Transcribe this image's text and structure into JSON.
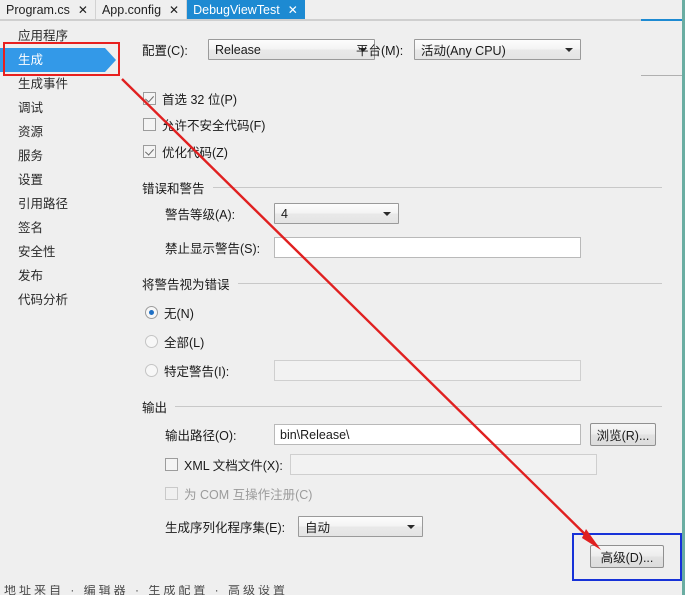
{
  "window": {
    "accent_blue": "#1d8ad2",
    "background": "#efefef",
    "highlight_red": "#e8201f",
    "highlight_blue": "#1732d8",
    "arrow_color": "#e02020"
  },
  "tabs": [
    {
      "label": "Program.cs",
      "close": "✕",
      "active": false
    },
    {
      "label": "App.config",
      "close": "✕",
      "active": false
    },
    {
      "label": "DebugViewTest",
      "close": "✕",
      "active": true
    }
  ],
  "sidebar": {
    "items": [
      {
        "label": "应用程序",
        "selected": false
      },
      {
        "label": "生成",
        "selected": true
      },
      {
        "label": "生成事件",
        "selected": false
      },
      {
        "label": "调试",
        "selected": false
      },
      {
        "label": "资源",
        "selected": false
      },
      {
        "label": "服务",
        "selected": false
      },
      {
        "label": "设置",
        "selected": false
      },
      {
        "label": "引用路径",
        "selected": false
      },
      {
        "label": "签名",
        "selected": false
      },
      {
        "label": "安全性",
        "selected": false
      },
      {
        "label": "发布",
        "selected": false
      },
      {
        "label": "代码分析",
        "selected": false
      }
    ]
  },
  "header": {
    "configuration_label": "配置(C):",
    "configuration_value": "Release",
    "platform_label": "平台(M):",
    "platform_value": "活动(Any CPU)"
  },
  "general": {
    "prefer32bit_label": "首选 32 位(P)",
    "prefer32bit_checked": true,
    "unsafe_label": "允许不安全代码(F)",
    "unsafe_checked": false,
    "optimize_label": "优化代码(Z)",
    "optimize_checked": true
  },
  "errors_warnings": {
    "group_title": "错误和警告",
    "warning_level_label": "警告等级(A):",
    "warning_level_value": "4",
    "suppress_label": "禁止显示警告(S):",
    "suppress_value": ""
  },
  "treat_warnings": {
    "group_title": "将警告视为错误",
    "options": [
      {
        "label": "无(N)",
        "selected": true
      },
      {
        "label": "全部(L)",
        "selected": false
      },
      {
        "label": "特定警告(I):",
        "selected": false
      }
    ],
    "specific_value": ""
  },
  "output": {
    "group_title": "输出",
    "path_label": "输出路径(O):",
    "path_value": "bin\\Release\\",
    "browse_label": "浏览(R)...",
    "xml_doc_label": "XML 文档文件(X):",
    "xml_doc_checked": false,
    "xml_doc_value": "",
    "com_interop_label": "为 COM 互操作注册(C)",
    "com_interop_checked": false,
    "com_interop_disabled": true,
    "serialization_label": "生成序列化程序集(E):",
    "serialization_value": "自动",
    "advanced_label": "高级(D)..."
  },
  "annotations": {
    "red_box_target": "生成",
    "blue_box_target": "高级(D)...",
    "arrow_from": "生成",
    "arrow_to": "高级(D)..."
  },
  "bottom_caption": "地址来自 · 编辑器 · 生成配置 · 高级设置"
}
